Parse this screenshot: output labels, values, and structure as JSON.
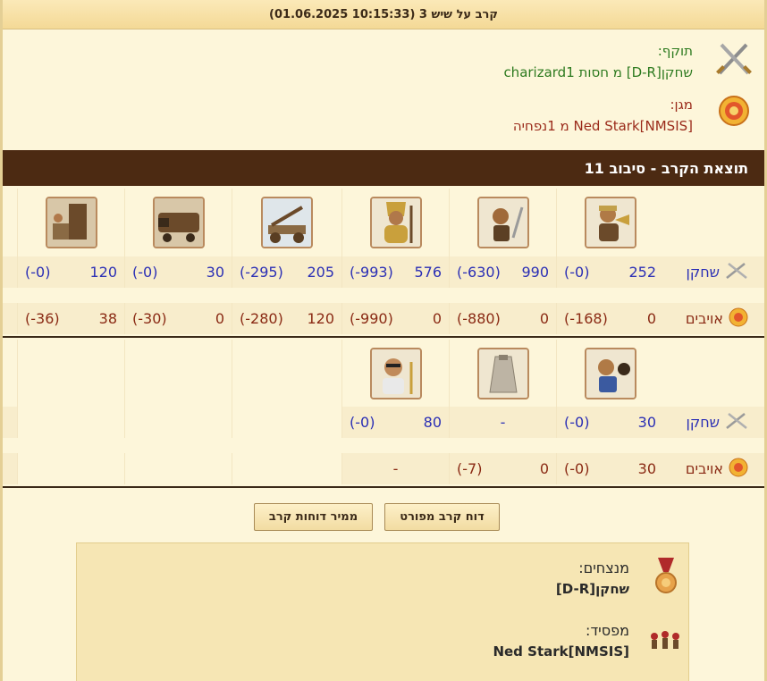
{
  "title": "קרב על שיש 3 (10:15:33 01.06.2025)",
  "attacker": {
    "label": "תוקף:",
    "name": "שחקן[D-R] מ חסות charizard1",
    "icon": "crossed-swords-icon"
  },
  "defender": {
    "label": "מגן:",
    "name": "Ned Stark[NMSIS] מ 1נפחיה",
    "icon": "shield-icon"
  },
  "round_title": "תוצאת הקרב - סיבוב 11",
  "side_labels": {
    "player": "שחקן",
    "enemies": "אויבים"
  },
  "group1": {
    "units": [
      "trumpeter-unit",
      "swordsman-unit",
      "spartan-unit",
      "catapult-unit",
      "ram-unit",
      "siege-tower-unit"
    ],
    "player": [
      {
        "count": "252",
        "loss": "(0-)"
      },
      {
        "count": "990",
        "loss": "(630-)"
      },
      {
        "count": "576",
        "loss": "(993-)"
      },
      {
        "count": "205",
        "loss": "(295-)"
      },
      {
        "count": "30",
        "loss": "(0-)"
      },
      {
        "count": "120",
        "loss": "(0-)"
      }
    ],
    "enemies": [
      {
        "count": "0",
        "loss": "(168-)"
      },
      {
        "count": "0",
        "loss": "(880-)"
      },
      {
        "count": "0",
        "loss": "(990-)"
      },
      {
        "count": "120",
        "loss": "(280-)"
      },
      {
        "count": "0",
        "loss": "(30-)"
      },
      {
        "count": "38",
        "loss": "(36-)"
      }
    ]
  },
  "group2": {
    "units": [
      "thrower-unit",
      "wall-unit",
      "doctor-unit"
    ],
    "player": [
      {
        "count": "30",
        "loss": "(0-)"
      },
      {
        "count": "-",
        "loss": ""
      },
      {
        "count": "80",
        "loss": "(0-)"
      }
    ],
    "enemies": [
      {
        "count": "30",
        "loss": "(0-)"
      },
      {
        "count": "0",
        "loss": "(7-)"
      },
      {
        "count": "-",
        "loss": ""
      }
    ]
  },
  "buttons": {
    "detailed": "דוח קרב מפורט",
    "convert": "ממיר דוחות קרב"
  },
  "outcome": {
    "winners_label": "מנצחים:",
    "winners": "שחקן[D-R]",
    "loser_label": "מפסיד:",
    "loser": "Ned Stark[NMSIS]"
  },
  "colors": {
    "player": "#2b2fb5",
    "enemies": "#8a2a14",
    "round_bar": "#4c2a12",
    "attacker_name": "#2d7a1f",
    "defender_name": "#9a2a1a"
  }
}
